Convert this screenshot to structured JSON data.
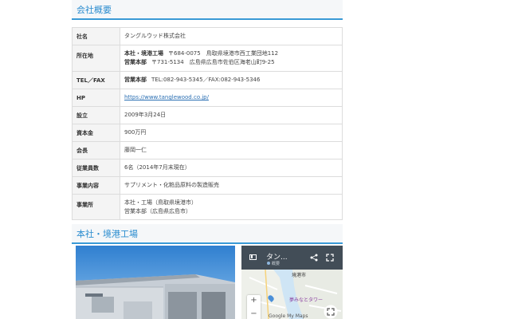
{
  "section1": {
    "title": "会社概要"
  },
  "rows": [
    {
      "label": "社名",
      "lines": [
        {
          "value": "タングルウッド株式会社"
        }
      ]
    },
    {
      "label": "所在地",
      "lines": [
        {
          "tag": "本社・境港工場",
          "value": "〒684-0075　鳥取県境港市西工業団地112"
        },
        {
          "tag": "営業本部",
          "value": "〒731-5134　広島県広島市佐伯区海老山町9-25"
        }
      ]
    },
    {
      "label": "TEL／FAX",
      "lines": [
        {
          "tag": "営業本部",
          "value": "TEL:082-943-5345／FAX:082-943-5346"
        }
      ]
    },
    {
      "label": "HP",
      "link": "https://www.tanglewood.co.jp/"
    },
    {
      "label": "設立",
      "lines": [
        {
          "value": "2009年3月24日"
        }
      ]
    },
    {
      "label": "資本金",
      "lines": [
        {
          "value": "900万円"
        }
      ]
    },
    {
      "label": "会長",
      "lines": [
        {
          "value": "藤岡一仁"
        }
      ]
    },
    {
      "label": "従業員数",
      "lines": [
        {
          "value": "6名（2014年7月末現在）"
        }
      ]
    },
    {
      "label": "事業内容",
      "lines": [
        {
          "value": "サプリメント・化粧品原料の製造販売"
        }
      ]
    },
    {
      "label": "事業所",
      "lines": [
        {
          "value": "本社・工場（鳥取県境港市）"
        },
        {
          "value": "営業本部（広島県広島市）"
        }
      ]
    }
  ],
  "section2": {
    "title": "本社・境港工場"
  },
  "map": {
    "title": "タン...",
    "subtitle": "概要",
    "city_label": "境港市",
    "landmark_label": "夢みなとタワー",
    "zoom_in": "+",
    "zoom_out": "−",
    "brand": "Google My Maps",
    "icons": [
      "sidebar-icon",
      "share-icon",
      "fullscreen-icon",
      "location-pin-icon",
      "fit-bounds-icon"
    ]
  },
  "colors": {
    "accent": "#2a8ccf",
    "map_header": "#424d57",
    "link": "#2a6fb3"
  }
}
